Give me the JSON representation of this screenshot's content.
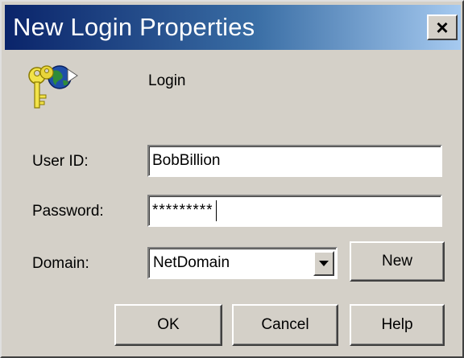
{
  "window": {
    "title": "New Login Properties",
    "close_label": "×"
  },
  "header": {
    "icon": "keys-globe-icon",
    "section_label": "Login"
  },
  "form": {
    "user_id": {
      "label": "User ID:",
      "value": "BobBillion"
    },
    "password": {
      "label": "Password:",
      "value": "*********"
    },
    "domain": {
      "label": "Domain:",
      "selected": "NetDomain"
    }
  },
  "buttons": {
    "new": "New",
    "ok": "OK",
    "cancel": "Cancel",
    "help": "Help"
  },
  "colors": {
    "title_gradient_start": "#0a246a",
    "title_gradient_end": "#a6caf0",
    "face": "#d4d0c8"
  }
}
